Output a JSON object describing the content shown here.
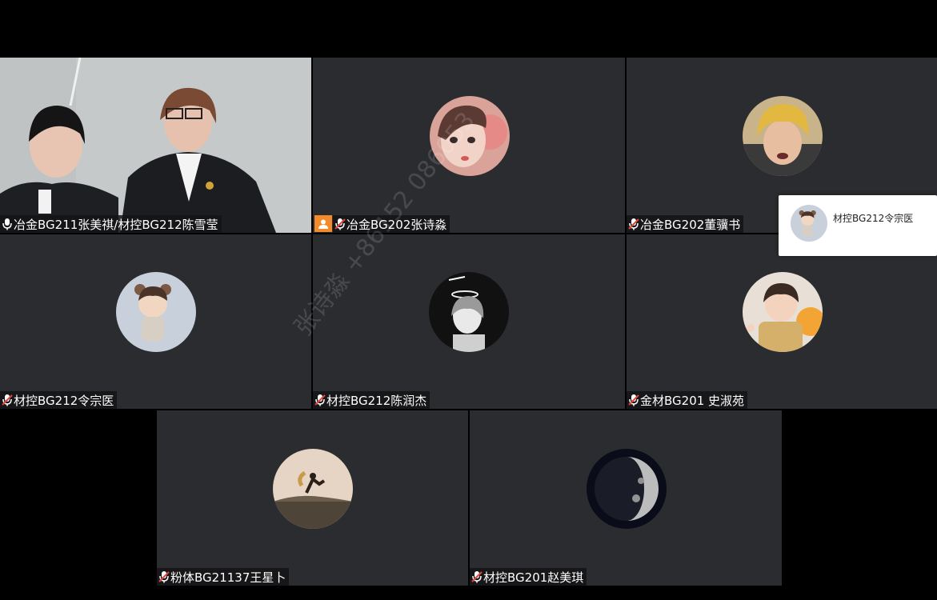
{
  "participants": [
    {
      "name": "冶金BG211张美祺/材控BG212陈雪莹",
      "mic": "on",
      "video": true
    },
    {
      "name": "冶金BG202张诗淼",
      "mic": "muted",
      "host": true
    },
    {
      "name": "冶金BG202董骥书",
      "mic": "muted"
    },
    {
      "name": "材控BG212令宗医",
      "mic": "muted"
    },
    {
      "name": "材控BG212陈润杰",
      "mic": "muted"
    },
    {
      "name": "金材BG201 史淑苑",
      "mic": "muted"
    },
    {
      "name": "粉体BG21137王星卜",
      "mic": "muted"
    },
    {
      "name": "材控BG201赵美琪",
      "mic": "muted"
    }
  ],
  "speaker_popup": {
    "name": "材控BG212令宗医"
  },
  "watermark": {
    "text": "张诗淼 +86152 086053"
  },
  "colors": {
    "tile_bg": "#2b2c2f",
    "host_badge": "#f58a2b",
    "muted_mic": "#e0443a"
  }
}
